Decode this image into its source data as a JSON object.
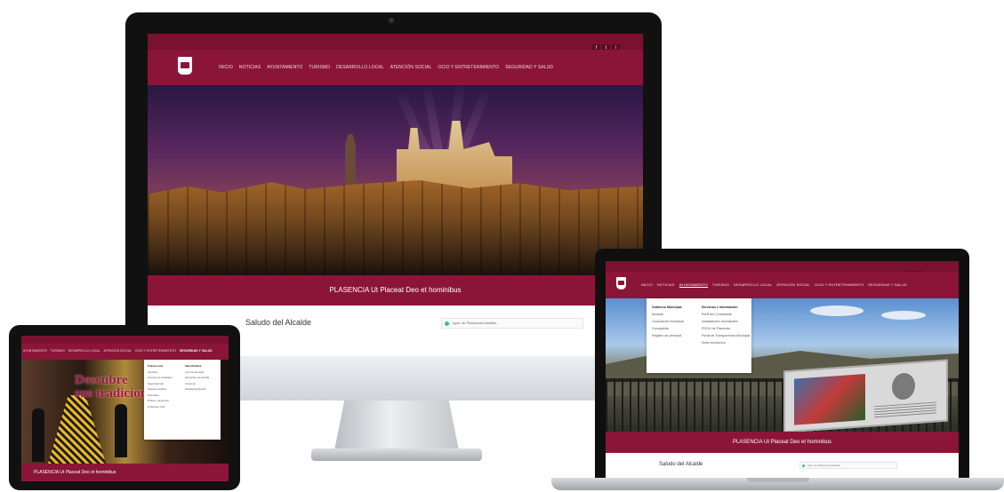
{
  "site": {
    "nav": [
      "INICIO",
      "NOTICIAS",
      "AYUNTAMIENTO",
      "TURISMO",
      "DESARROLLO LOCAL",
      "ATENCIÓN SOCIAL",
      "OCIO Y ENTRETENIMIENTO",
      "SEGURIDAD Y SALUD"
    ],
    "social_icons": [
      "facebook-icon",
      "twitter-icon",
      "instagram-icon"
    ],
    "social_glyphs": [
      "f",
      "t",
      "i"
    ],
    "motto": "PLASENCIA Ut Placeat Deo et hominibus",
    "saludo": "Saludo del Alcalde",
    "widget_text": "Ayto. de Plasencia retwitteó"
  },
  "laptop": {
    "active_nav": "AYUNTAMIENTO",
    "dropdown_col1": [
      "Gobierno Municipal",
      "Alcaldía",
      "Corporación Municipal",
      "Concejalías",
      "Registro de personal"
    ],
    "dropdown_col2": [
      "Servicios e información",
      "Perfil del Contratante",
      "Instalaciones municipales",
      "PGOU de Plasencia",
      "Portal de Transparencia Municipal",
      "Sede electrónica"
    ]
  },
  "tablet": {
    "active_nav": "SEGURIDAD Y SALUD",
    "headline_line1": "Descubre",
    "headline_line2": "sus tradiciones",
    "dropdown_col1": [
      "Policía Local",
      "Servicios",
      "Atención al ciudadano",
      "Seguridad vial",
      "Objetos perdidos",
      "Normativa",
      "Multas y sanciones",
      "Protección Civil"
    ],
    "dropdown_col2": [
      "Salud Pública",
      "Centros de salud",
      "Farmacias de guardia",
      "Consumo",
      "Sanidad ambiental"
    ]
  },
  "colors": {
    "brand_maroon": "#8b1538",
    "brand_maroon_dark": "#7a1131"
  }
}
